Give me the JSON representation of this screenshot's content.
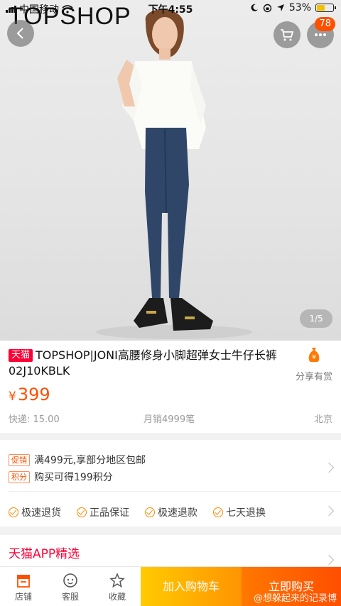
{
  "status_bar": {
    "carrier": "中国移动",
    "time": "下午4:55",
    "battery": "53%",
    "battery_level": 0.53
  },
  "header": {
    "brand": "TOPSHOP",
    "cart_badge": "78"
  },
  "gallery": {
    "indicator": "1/5"
  },
  "product": {
    "tag": "天猫",
    "title": "TOPSHOP|JONI高腰修身小脚超弹女士牛仔长裤02J10KBLK",
    "currency": "¥",
    "price": "399",
    "shipping": "快递: 15.00",
    "monthly_sales": "月销4999笔",
    "location": "北京",
    "share_label": "分享有赏"
  },
  "promotions": [
    {
      "tag": "促销",
      "text": "满499元,享部分地区包邮"
    },
    {
      "tag": "积分",
      "text": "购买可得199积分"
    }
  ],
  "services": [
    "极速退货",
    "正品保证",
    "极速退款",
    "七天退换"
  ],
  "section": {
    "title": "天猫APP精选"
  },
  "bottom_bar": {
    "tabs": [
      {
        "label": "店铺",
        "icon": "store-icon"
      },
      {
        "label": "客服",
        "icon": "customer-service-icon"
      },
      {
        "label": "收藏",
        "icon": "star-icon"
      }
    ],
    "add_to_cart": "加入购物车",
    "buy_now": "立即购买",
    "watermark": "@想躲起来的记录博"
  },
  "colors": {
    "accent": "#ff5000",
    "tmall_red": "#ff0036"
  }
}
